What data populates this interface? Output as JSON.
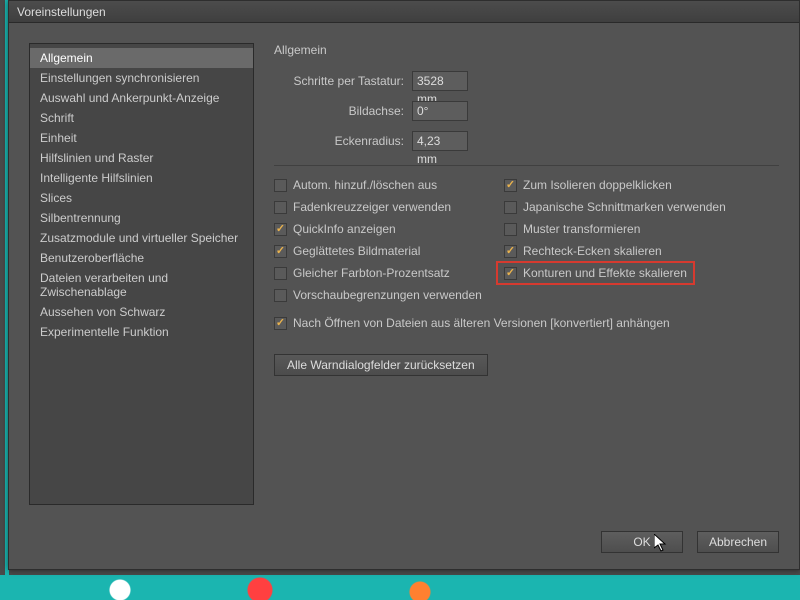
{
  "window": {
    "title": "Voreinstellungen"
  },
  "sidebar": {
    "items": [
      "Allgemein",
      "Einstellungen synchronisieren",
      "Auswahl und Ankerpunkt-Anzeige",
      "Schrift",
      "Einheit",
      "Hilfslinien und Raster",
      "Intelligente Hilfslinien",
      "Slices",
      "Silbentrennung",
      "Zusatzmodule und virtueller Speicher",
      "Benutzeroberfläche",
      "Dateien verarbeiten und Zwischenablage",
      "Aussehen von Schwarz",
      "Experimentelle Funktion"
    ],
    "selected_index": 0
  },
  "main": {
    "heading": "Allgemein",
    "fields": {
      "keyboard_increment": {
        "label": "Schritte per Tastatur:",
        "value": "3528 mm"
      },
      "constrain_angle": {
        "label": "Bildachse:",
        "value": "0°"
      },
      "corner_radius": {
        "label": "Eckenradius:",
        "value": "4,23 mm"
      }
    },
    "checks_left": [
      {
        "label": "Autom. hinzuf./löschen aus",
        "checked": false
      },
      {
        "label": "Fadenkreuzzeiger verwenden",
        "checked": false
      },
      {
        "label": "QuickInfo anzeigen",
        "checked": true
      },
      {
        "label": "Geglättetes Bildmaterial",
        "checked": true
      },
      {
        "label": "Gleicher Farbton-Prozentsatz",
        "checked": false
      },
      {
        "label": "Vorschaubegrenzungen verwenden",
        "checked": false
      }
    ],
    "checks_right": [
      {
        "label": "Zum Isolieren doppelklicken",
        "checked": true
      },
      {
        "label": "Japanische Schnittmarken verwenden",
        "checked": false
      },
      {
        "label": "Muster transformieren",
        "checked": false
      },
      {
        "label": "Rechteck-Ecken skalieren",
        "checked": true
      },
      {
        "label": "Konturen und Effekte skalieren",
        "checked": true,
        "highlight": true
      }
    ],
    "append_converted": {
      "label": "Nach Öffnen von Dateien aus älteren Versionen [konvertiert] anhängen",
      "checked": true
    },
    "reset_warnings_label": "Alle Warndialogfelder zurücksetzen"
  },
  "footer": {
    "ok": "OK",
    "cancel": "Abbrechen"
  }
}
